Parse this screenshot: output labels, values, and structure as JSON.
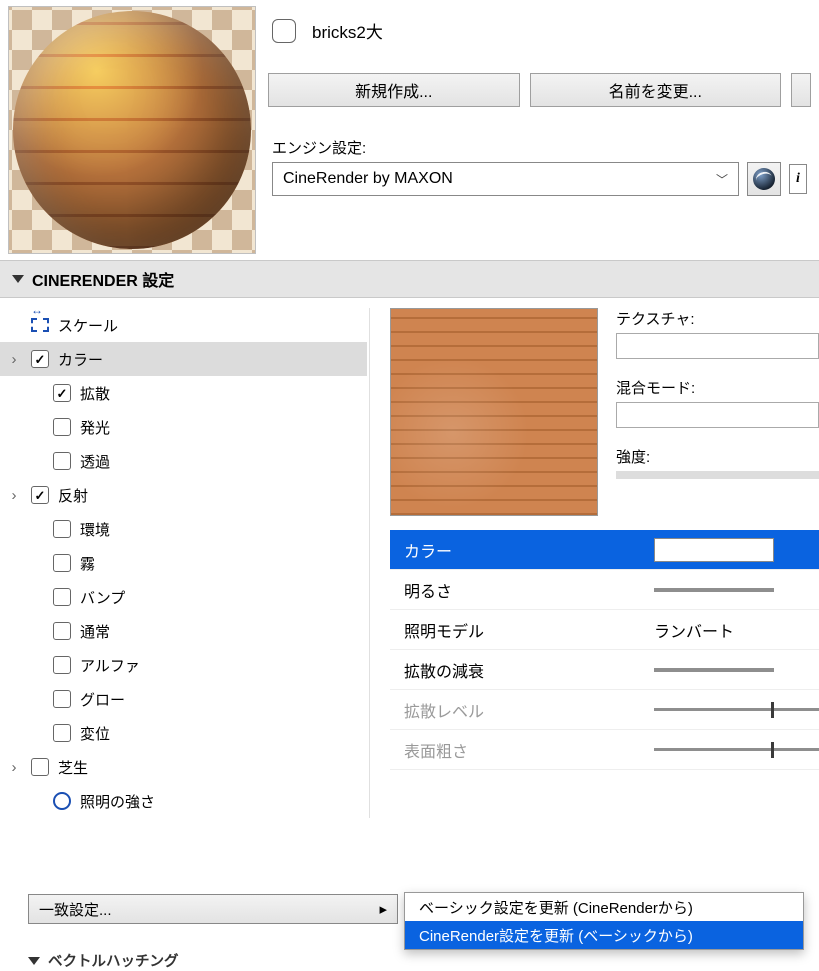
{
  "material": {
    "enabled": false,
    "name": "bricks2大"
  },
  "buttons": {
    "new": "新規作成...",
    "rename": "名前を変更..."
  },
  "engine": {
    "label": "エンジン設定:",
    "selected": "CineRender by MAXON"
  },
  "section_title": "CINERENDER 設定",
  "tree": {
    "scale": {
      "label": "スケール"
    },
    "color": {
      "label": "カラー",
      "checked": true,
      "expandable": true,
      "selected": true
    },
    "diffuse": {
      "label": "拡散",
      "checked": true
    },
    "luminance": {
      "label": "発光",
      "checked": false
    },
    "transparency": {
      "label": "透過",
      "checked": false
    },
    "reflection": {
      "label": "反射",
      "checked": true,
      "expandable": true
    },
    "environment": {
      "label": "環境",
      "checked": false
    },
    "fog": {
      "label": "霧",
      "checked": false
    },
    "bump": {
      "label": "バンプ",
      "checked": false
    },
    "normal": {
      "label": "通常",
      "checked": false
    },
    "alpha": {
      "label": "アルファ",
      "checked": false
    },
    "glow": {
      "label": "グロー",
      "checked": false
    },
    "displacement": {
      "label": "変位",
      "checked": false
    },
    "grass": {
      "label": "芝生",
      "checked": false,
      "expandable": true
    },
    "illum": {
      "label": "照明の強さ"
    }
  },
  "right": {
    "texture_label": "テクスチャ:",
    "blend_label": "混合モード:",
    "strength_label": "強度:"
  },
  "props": {
    "color": {
      "label": "カラー"
    },
    "brightness": {
      "label": "明るさ"
    },
    "model": {
      "label": "照明モデル",
      "value": "ランバート"
    },
    "falloff": {
      "label": "拡散の減衰"
    },
    "diff_level": {
      "label": "拡散レベル"
    },
    "roughness": {
      "label": "表面粗さ"
    }
  },
  "match": {
    "button": "一致設定...",
    "options": {
      "from_cr": "ベーシック設定を更新 (CineRenderから)",
      "from_basic": "CineRender設定を更新 (ベーシックから)"
    }
  },
  "footer_partial": "ベクトルハッチング"
}
